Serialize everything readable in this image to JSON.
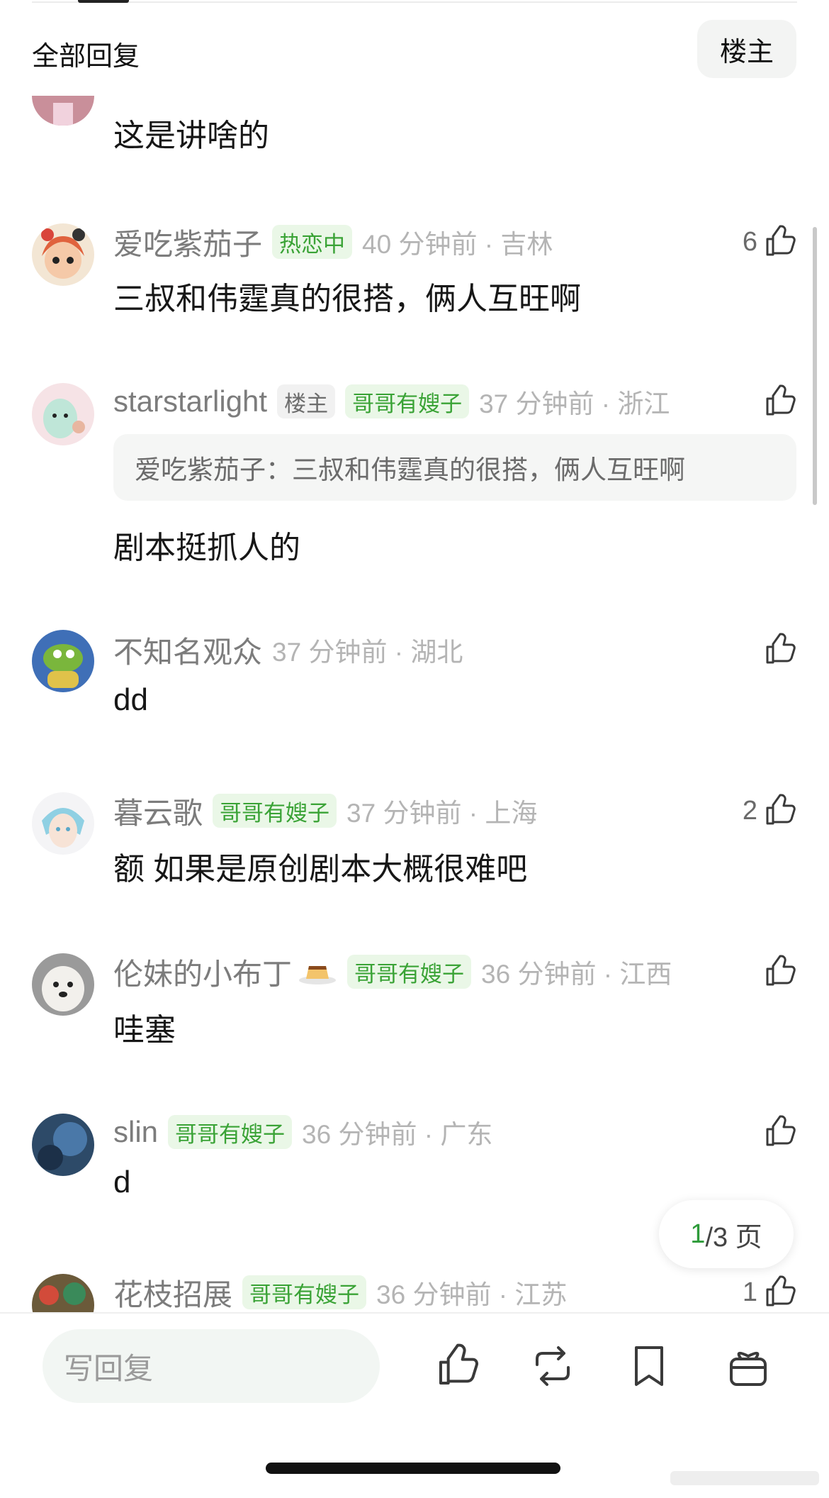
{
  "header": {
    "title": "全部回复",
    "owner_filter": "楼主"
  },
  "comments": [
    {
      "text": "这是讲啥的"
    },
    {
      "name": "爱吃紫茄子",
      "tag": "热恋中",
      "time": "40 分钟前 · 吉林",
      "likes": "6",
      "text": "三叔和伟霆真的很搭，俩人互旺啊",
      "avatar": "avatar-cartoon-girl"
    },
    {
      "name": "starstarlight",
      "owner_tag": "楼主",
      "tag": "哥哥有嫂子",
      "time": "37 分钟前 · 浙江",
      "quote": "爱吃紫茄子：三叔和伟霆真的很搭，俩人互旺啊",
      "text": "剧本挺抓人的",
      "avatar": "avatar-green-cat"
    },
    {
      "name": "不知名观众",
      "time": "37 分钟前 · 湖北",
      "text": "dd",
      "avatar": "avatar-green-bird"
    },
    {
      "name": "暮云歌",
      "tag": "哥哥有嫂子",
      "time": "37 分钟前 · 上海",
      "likes": "2",
      "text": "额 如果是原创剧本大概很难吧",
      "avatar": "avatar-anime-boy"
    },
    {
      "name": "伦妹的小布丁",
      "emoji": "pudding-emoji",
      "tag": "哥哥有嫂子",
      "time": "36 分钟前 · 江西",
      "text": "哇塞",
      "avatar": "avatar-white-dog"
    },
    {
      "name": "slin",
      "tag": "哥哥有嫂子",
      "time": "36 分钟前 · 广东",
      "text": "d",
      "avatar": "avatar-blue-sky"
    },
    {
      "name": "花枝招展",
      "tag": "哥哥有嫂子",
      "time": "36 分钟前 · 江苏",
      "likes": "1",
      "avatar": "avatar-colorful"
    }
  ],
  "pager": {
    "current": "1",
    "rest": "/3 页"
  },
  "bottom_bar": {
    "reply_placeholder": "写回复",
    "icons": [
      "like-icon",
      "repost-icon",
      "bookmark-icon",
      "gift-icon"
    ]
  },
  "colors": {
    "accent_green": "#3aa336",
    "tag_bg": "#eaf7e7"
  }
}
